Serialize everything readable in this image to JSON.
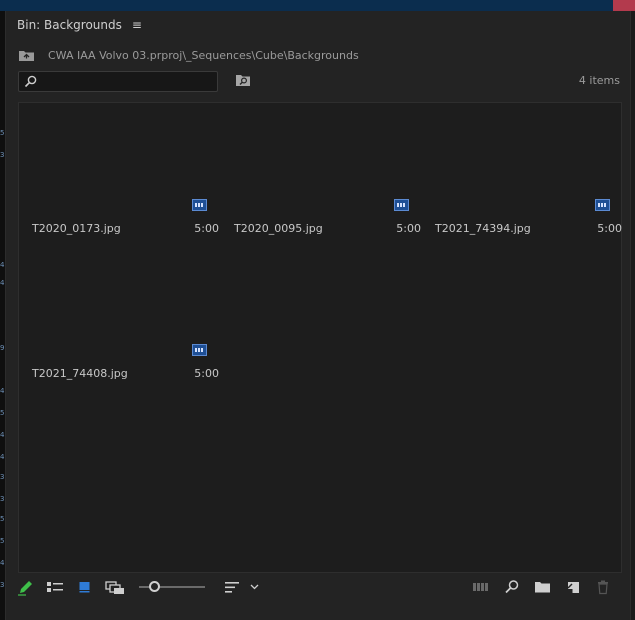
{
  "panel": {
    "title": "Bin: Backgrounds",
    "menu_icon": "hamburger-menu-icon"
  },
  "path": {
    "text": "CWA IAA Volvo 03.prproj\\_Sequences\\Cube\\Backgrounds",
    "icon": "folder-up-icon"
  },
  "search": {
    "value": "",
    "placeholder": ""
  },
  "item_count": "4 items",
  "items": [
    {
      "name": "T2020_0173.jpg",
      "duration": "5:00"
    },
    {
      "name": "T2020_0095.jpg",
      "duration": "5:00"
    },
    {
      "name": "T2021_74394.jpg",
      "duration": "5:00"
    },
    {
      "name": "T2021_74408.jpg",
      "duration": "5:00"
    }
  ],
  "footer": {
    "icons": [
      "pencil-icon",
      "list-view-icon",
      "icon-view-icon",
      "freeform-view-icon",
      "zoom-slider",
      "sort-icon",
      "chevron-down-icon",
      "automate-to-sequence-icon",
      "find-icon",
      "new-bin-icon",
      "new-item-icon",
      "trash-icon"
    ]
  },
  "colors": {
    "accent": "#2f7bd6",
    "pencil": "#3fbf4a",
    "text": "#c8c8c8"
  }
}
